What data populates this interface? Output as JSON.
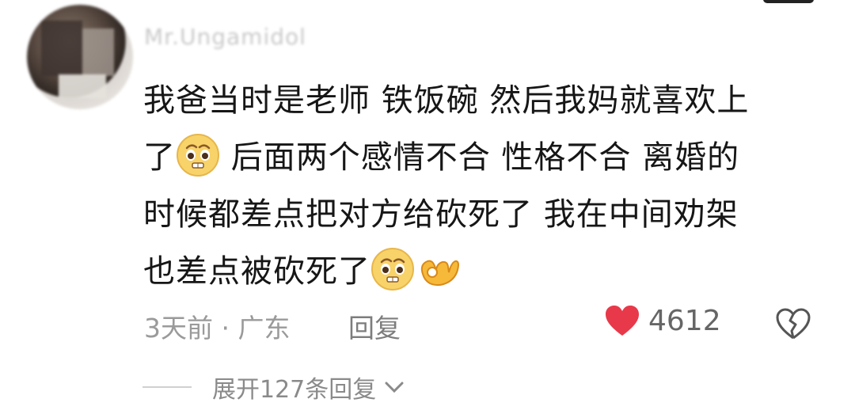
{
  "comment": {
    "username": "Mr.Ungamidol",
    "lines": [
      "我爸当时是老师 铁饭碗 然后我妈就喜欢上",
      "了",
      " 后面两个感情不合 性格不合 离婚的",
      "时候都差点把对方给砍死了 我在中间劝架",
      "也差点被砍死了"
    ],
    "time_location": "3天前 · 广东",
    "reply_label": "回复",
    "like_count": "4612",
    "expand_label": "展开127条回复"
  },
  "icons": {
    "emoji_pleading": "pleading-face-emoji",
    "emoji_ok": "ok-hand-emoji",
    "like": "heart-icon",
    "dislike": "broken-heart-icon",
    "expand": "chevron-down-icon"
  },
  "colors": {
    "heart": "#e8394a",
    "text": "#161616",
    "meta": "#9a9a9a"
  }
}
